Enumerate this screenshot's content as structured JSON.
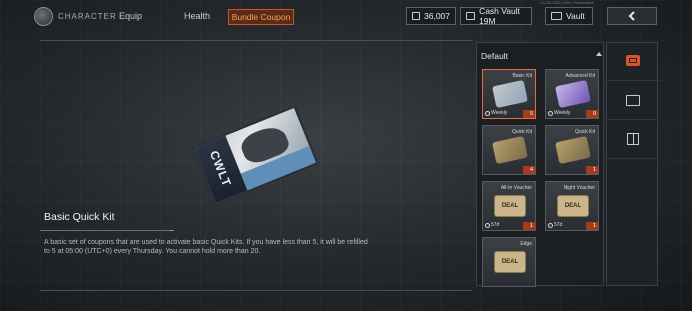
{
  "header": {
    "section": "CHARACTER",
    "tabs": [
      {
        "label": "Equip",
        "active": false
      },
      {
        "label": "Health",
        "active": false
      },
      {
        "label": "Bundle Coupon",
        "active": true
      }
    ],
    "currency": {
      "cash": "36,007",
      "vault_cash": "Cash Vault 19M",
      "vault": "Vault"
    },
    "debug_info": "1.8.231.2021 | 0/0/0 | Performance"
  },
  "preview": {
    "label": "CWLT"
  },
  "details": {
    "title": "Basic Quick Kit",
    "description": "A basic set of coupons that are used to activate basic Quick Kits. If you have less than 5, it will be refilled to 5 at 05:00 (UTC+0) every Thursday. You cannot hold more than 20."
  },
  "inventory": {
    "group_label": "Default",
    "items": [
      {
        "name": "Basic Kit",
        "tag": "Weekly",
        "count": "5",
        "selected": true
      },
      {
        "name": "Advanced Kit",
        "tag": "Weekly",
        "count": "0",
        "selected": false
      },
      {
        "name": "Quick Kit",
        "tag": "",
        "count": "4",
        "selected": false
      },
      {
        "name": "Quick Kit",
        "tag": "",
        "count": "1",
        "selected": false
      },
      {
        "name": "All-In Voucher",
        "tag": "57d",
        "count": "1",
        "selected": false
      },
      {
        "name": "Night Voucher",
        "tag": "57d",
        "count": "1",
        "selected": false
      },
      {
        "name": "Edge",
        "tag": "",
        "count": "",
        "selected": false
      }
    ],
    "deal_text": "DEAL"
  },
  "side_tabs": [
    "coupon-icon",
    "id-card-icon",
    "gift-icon"
  ],
  "colors": {
    "accent": "#d9542a",
    "count_badge": "#a63a1e",
    "info_accent": "#4fb0d8"
  }
}
